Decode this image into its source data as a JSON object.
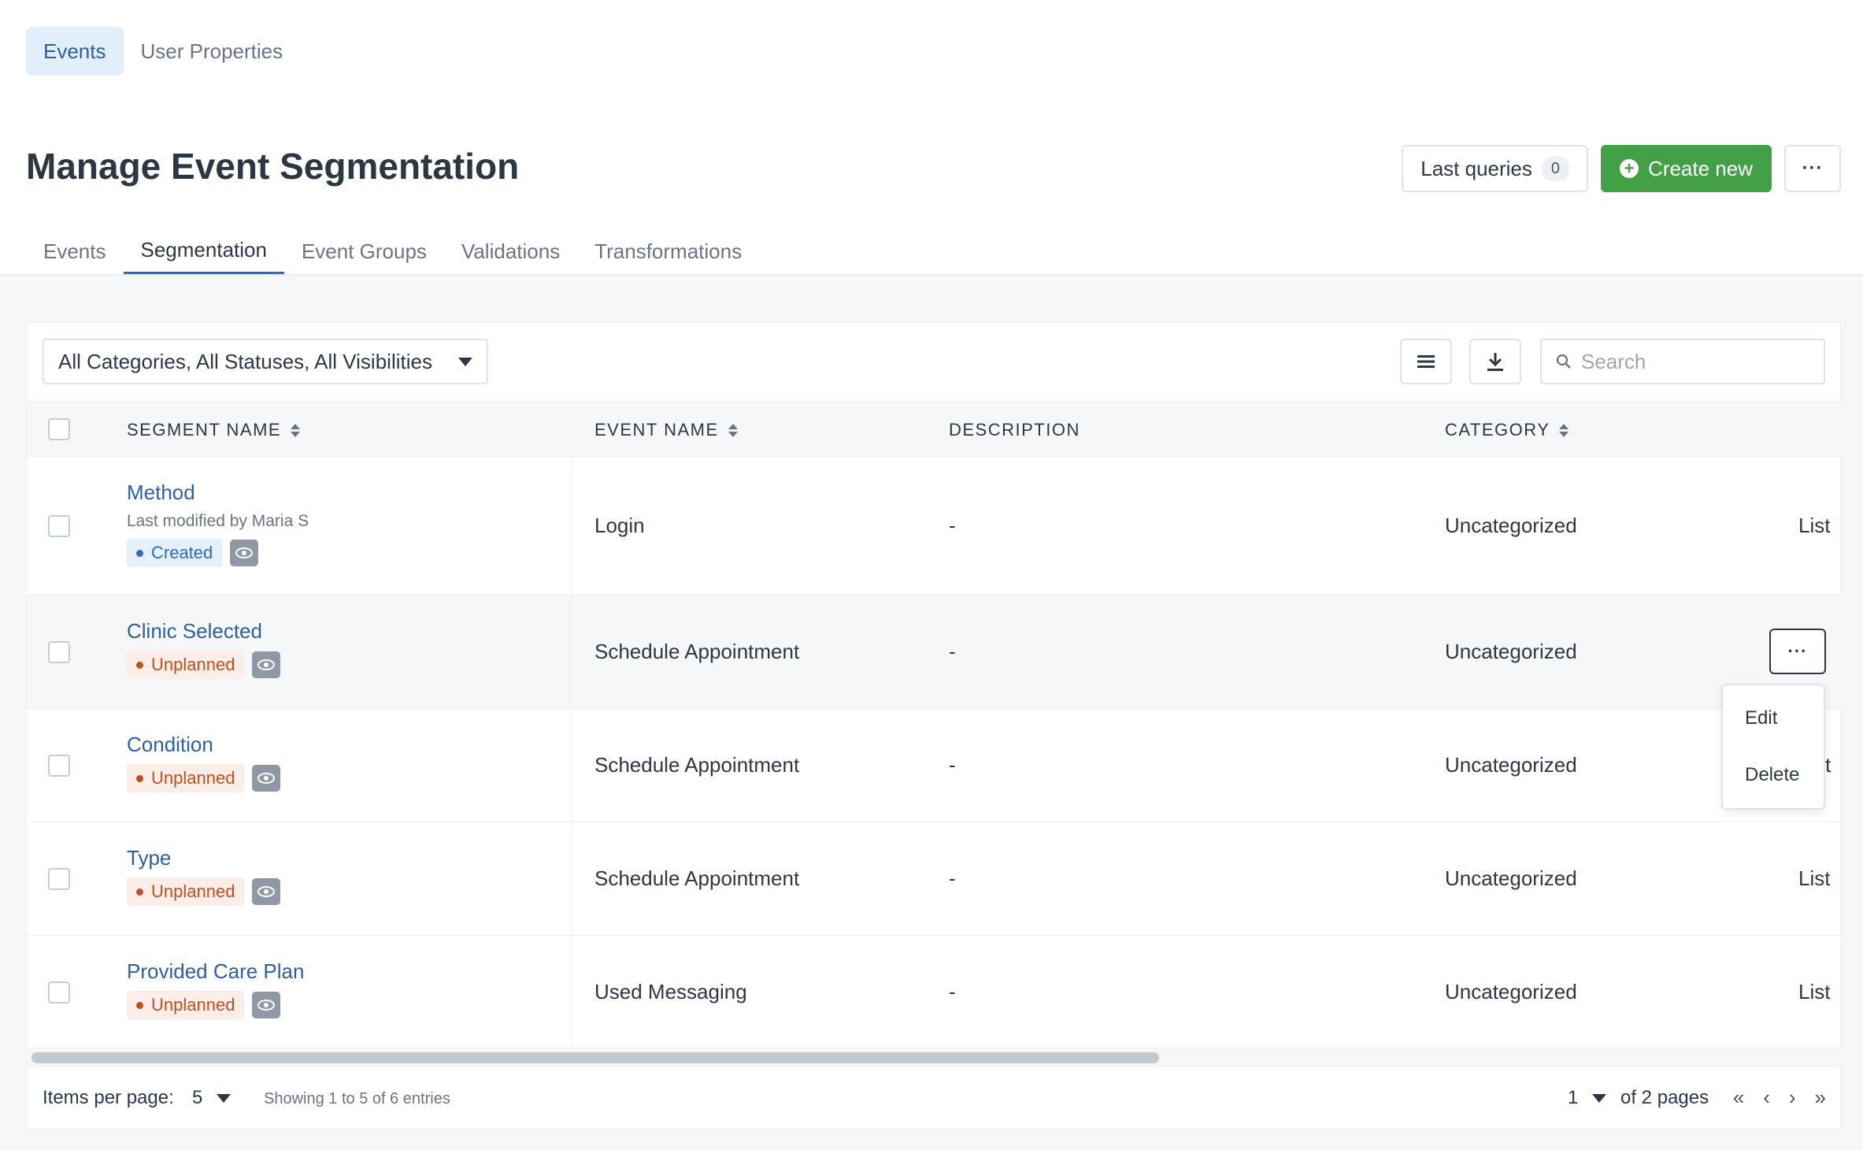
{
  "top_tabs": [
    {
      "label": "Events",
      "active": true
    },
    {
      "label": "User Properties",
      "active": false
    }
  ],
  "page": {
    "title": "Manage Event Segmentation"
  },
  "header_actions": {
    "last_queries_label": "Last queries",
    "last_queries_count": "0",
    "create_new_label": "Create new",
    "more_icon": "ellipsis-icon"
  },
  "sub_tabs": [
    {
      "label": "Events",
      "active": false
    },
    {
      "label": "Segmentation",
      "active": true
    },
    {
      "label": "Event Groups",
      "active": false
    },
    {
      "label": "Validations",
      "active": false
    },
    {
      "label": "Transformations",
      "active": false
    }
  ],
  "filters": {
    "selected": "All Categories, All Statuses, All Visibilities",
    "search_placeholder": "Search"
  },
  "table": {
    "columns": [
      "SEGMENT NAME",
      "EVENT NAME",
      "DESCRIPTION",
      "CATEGORY"
    ],
    "rows": [
      {
        "segment": "Method",
        "meta": "Last modified by Maria S",
        "status": "Created",
        "event": "Login",
        "description": "-",
        "category": "Uncategorized",
        "trailing": "List"
      },
      {
        "segment": "Clinic Selected",
        "meta": "",
        "status": "Unplanned",
        "event": "Schedule Appointment",
        "description": "-",
        "category": "Uncategorized",
        "trailing": ""
      },
      {
        "segment": "Condition",
        "meta": "",
        "status": "Unplanned",
        "event": "Schedule Appointment",
        "description": "-",
        "category": "Uncategorized",
        "trailing": "t"
      },
      {
        "segment": "Type",
        "meta": "",
        "status": "Unplanned",
        "event": "Schedule Appointment",
        "description": "-",
        "category": "Uncategorized",
        "trailing": "List"
      },
      {
        "segment": "Provided Care Plan",
        "meta": "",
        "status": "Unplanned",
        "event": "Used Messaging",
        "description": "-",
        "category": "Uncategorized",
        "trailing": "List"
      }
    ]
  },
  "row_menu": {
    "items": [
      "Edit",
      "Delete"
    ]
  },
  "footer": {
    "items_per_page_label": "Items per page:",
    "items_per_page_value": "5",
    "showing": "Showing 1 to 5 of 6 entries",
    "page_value": "1",
    "of_pages": "of 2 pages"
  },
  "colors": {
    "accent": "#2d6bc4",
    "create_button": "#43a047",
    "unplanned": "#c2501f"
  }
}
